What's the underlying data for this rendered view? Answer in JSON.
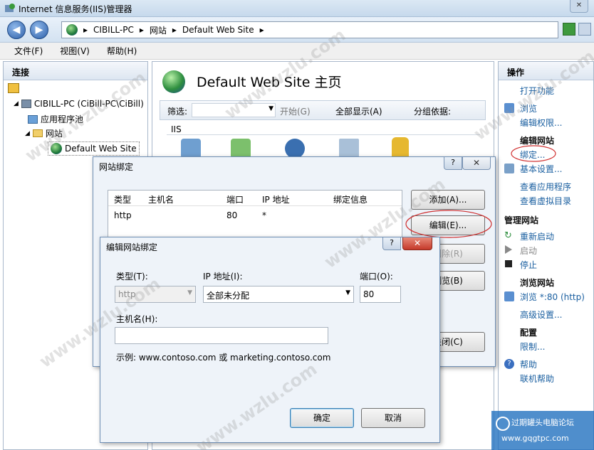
{
  "window": {
    "title": "Internet 信息服务(IIS)管理器",
    "title_icon": "iis-icon"
  },
  "address": {
    "segments": [
      "CIBILL-PC",
      "网站",
      "Default Web Site"
    ],
    "separator": "▸"
  },
  "menu": [
    "文件(F)",
    "视图(V)",
    "帮助(H)"
  ],
  "left": {
    "header": "连接",
    "tree": [
      {
        "label": "CIBILL-PC (CiBill-PC\\CiBill)",
        "icon": "computer-icon"
      },
      {
        "label": "应用程序池",
        "icon": "app-pool-icon"
      },
      {
        "label": "网站",
        "icon": "folder-icon"
      },
      {
        "label": "Default Web Site",
        "icon": "globe-icon"
      }
    ]
  },
  "center": {
    "title": "Default Web Site 主页",
    "filter_label": "筛选:",
    "start_label": "开始(G)",
    "show_all_label": "全部显示(A)",
    "group_label": "分组依据:",
    "section_label": "IIS"
  },
  "right": {
    "header": "操作",
    "items": [
      {
        "type": "link",
        "text": "打开功能"
      },
      {
        "type": "link",
        "text": "浏览"
      },
      {
        "type": "link",
        "text": "编辑权限..."
      },
      {
        "type": "section",
        "text": "编辑网站"
      },
      {
        "type": "link",
        "text": "绑定..."
      },
      {
        "type": "link",
        "text": "基本设置..."
      },
      {
        "type": "link",
        "text": "查看应用程序"
      },
      {
        "type": "link",
        "text": "查看虚拟目录"
      },
      {
        "type": "section",
        "text": "管理网站"
      },
      {
        "type": "link",
        "text": "重新启动"
      },
      {
        "type": "link",
        "text": "启动"
      },
      {
        "type": "link",
        "text": "停止"
      },
      {
        "type": "section",
        "text": "浏览网站"
      },
      {
        "type": "link",
        "text": "浏览 *:80 (http)"
      },
      {
        "type": "link",
        "text": "高级设置..."
      },
      {
        "type": "section",
        "text": "配置"
      },
      {
        "type": "link",
        "text": "限制..."
      },
      {
        "type": "link",
        "text": "帮助"
      },
      {
        "type": "link",
        "text": "联机帮助"
      }
    ]
  },
  "bindings_dialog": {
    "title": "网站绑定",
    "help": "?",
    "close": "✕",
    "columns": [
      "类型",
      "主机名",
      "端口",
      "IP 地址",
      "绑定信息"
    ],
    "rows": [
      {
        "type": "http",
        "host": "",
        "port": "80",
        "ip": "*",
        "info": ""
      }
    ],
    "buttons": {
      "add": "添加(A)...",
      "edit": "编辑(E)...",
      "remove": "删除(R)",
      "browse": "浏览(B)",
      "close": "关闭(C)"
    }
  },
  "edit_dialog": {
    "title": "编辑网站绑定",
    "help": "?",
    "close": "✕",
    "type_label": "类型(T):",
    "type_value": "http",
    "ip_label": "IP 地址(I):",
    "ip_value": "全部未分配",
    "port_label": "端口(O):",
    "port_value": "80",
    "host_label": "主机名(H):",
    "host_value": "",
    "example": "示例: www.contoso.com 或 marketing.contoso.com",
    "ok": "确定",
    "cancel": "取消"
  },
  "watermark": {
    "text": "www.wzlu.com",
    "forum": "过期罐头电脑论坛",
    "forum_url": "www.gqgtpc.com"
  },
  "colors": {
    "link": "#1a5fa0",
    "highlight_ellipse": "#d03030",
    "dialog_border": "#6f8fb5"
  }
}
